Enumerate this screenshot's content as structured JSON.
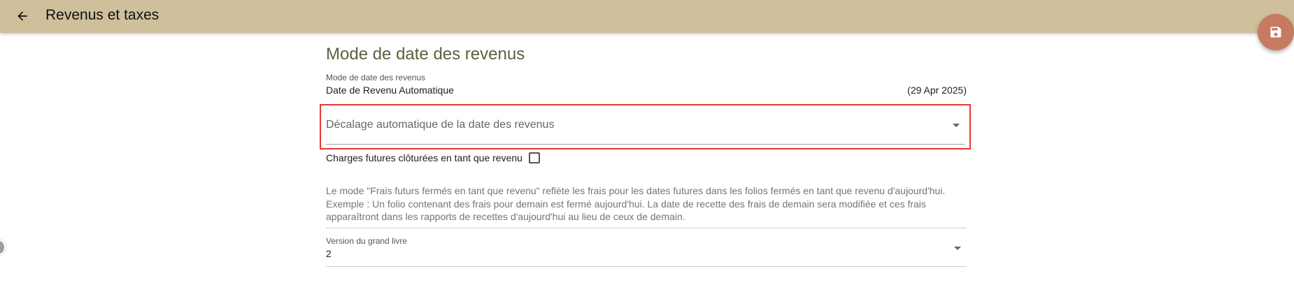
{
  "appbar": {
    "title": "Revenus et taxes",
    "back_icon": "arrow-left-icon",
    "background": "#cfbf9b"
  },
  "fab": {
    "icon": "floppy-disk-save-icon",
    "color": "#c67a5f"
  },
  "section": {
    "title": "Mode de date des revenus"
  },
  "revenue_date_mode": {
    "label": "Mode de date des revenus",
    "value": "Date de Revenu Automatique",
    "date": "(29 Apr 2025)"
  },
  "offset_select": {
    "placeholder": "Décalage automatique de la date des revenus",
    "highlight_color": "#e53935"
  },
  "future_charges": {
    "label": "Charges futures clôturées en tant que revenu",
    "checked": false
  },
  "help": {
    "line1": "Le mode \"Frais futurs fermés en tant que revenu\" reflète les frais pour les dates futures dans les folios fermés en tant que revenu d'aujourd'hui.",
    "line2": "Exemple : Un folio contenant des frais pour demain est fermé aujourd'hui. La date de recette des frais de demain sera modifiée et ces frais",
    "line3": "apparaîtront dans les rapports de recettes d'aujourd'hui au lieu de ceux de demain."
  },
  "ledger_version": {
    "label": "Version du grand livre",
    "value": "2"
  }
}
